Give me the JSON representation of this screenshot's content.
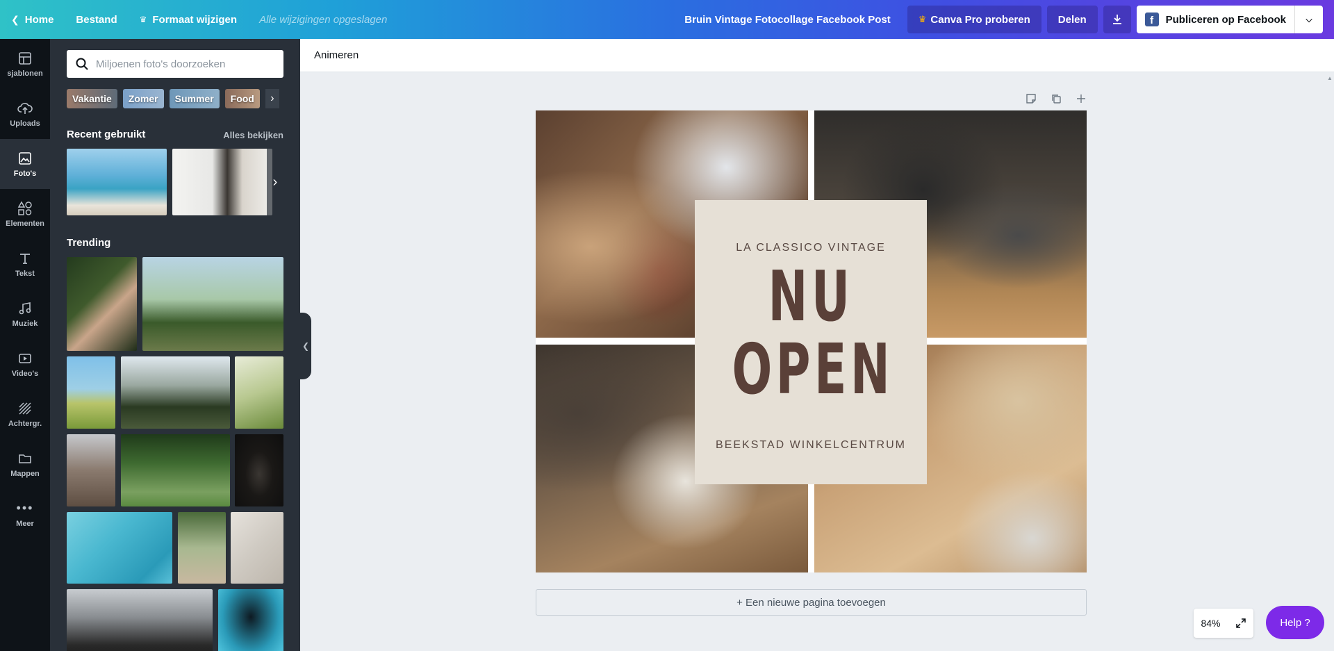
{
  "topbar": {
    "home": "Home",
    "file": "Bestand",
    "resize": "Formaat wijzigen",
    "saved": "Alle wijzigingen opgeslagen",
    "title": "Bruin Vintage Fotocollage Facebook Post",
    "pro": "Canva Pro proberen",
    "share": "Delen",
    "publish": "Publiceren op Facebook"
  },
  "rail": {
    "items": [
      {
        "label": "sjablonen",
        "icon": "template-icon"
      },
      {
        "label": "Uploads",
        "icon": "upload-icon"
      },
      {
        "label": "Foto's",
        "icon": "photo-icon"
      },
      {
        "label": "Elementen",
        "icon": "elements-icon"
      },
      {
        "label": "Tekst",
        "icon": "text-icon"
      },
      {
        "label": "Muziek",
        "icon": "music-icon"
      },
      {
        "label": "Video's",
        "icon": "video-icon"
      },
      {
        "label": "Achtergr.",
        "icon": "background-icon"
      },
      {
        "label": "Mappen",
        "icon": "folder-icon"
      },
      {
        "label": "Meer",
        "icon": "more-icon"
      }
    ]
  },
  "panel": {
    "search_placeholder": "Miljoenen foto's doorzoeken",
    "chips": [
      "Vakantie",
      "Zomer",
      "Summer",
      "Food"
    ],
    "recent_title": "Recent gebruikt",
    "see_all": "Alles bekijken",
    "trending_title": "Trending"
  },
  "editor": {
    "animate": "Animeren",
    "add_page": "+ Een nieuwe pagina toevoegen",
    "zoom": "84%",
    "help": "Help  ?"
  },
  "design": {
    "subtitle": "LA CLASSICO VINTAGE",
    "line1": "NU",
    "line2": "OPEN",
    "footer": "BEEKSTAD WINKELCENTRUM"
  },
  "colors": {
    "accent": "#7d2ae8",
    "rail_bg": "#0e1318",
    "panel_bg": "#293039",
    "card_bg": "#e6e0d6",
    "card_text": "#5a4038"
  }
}
